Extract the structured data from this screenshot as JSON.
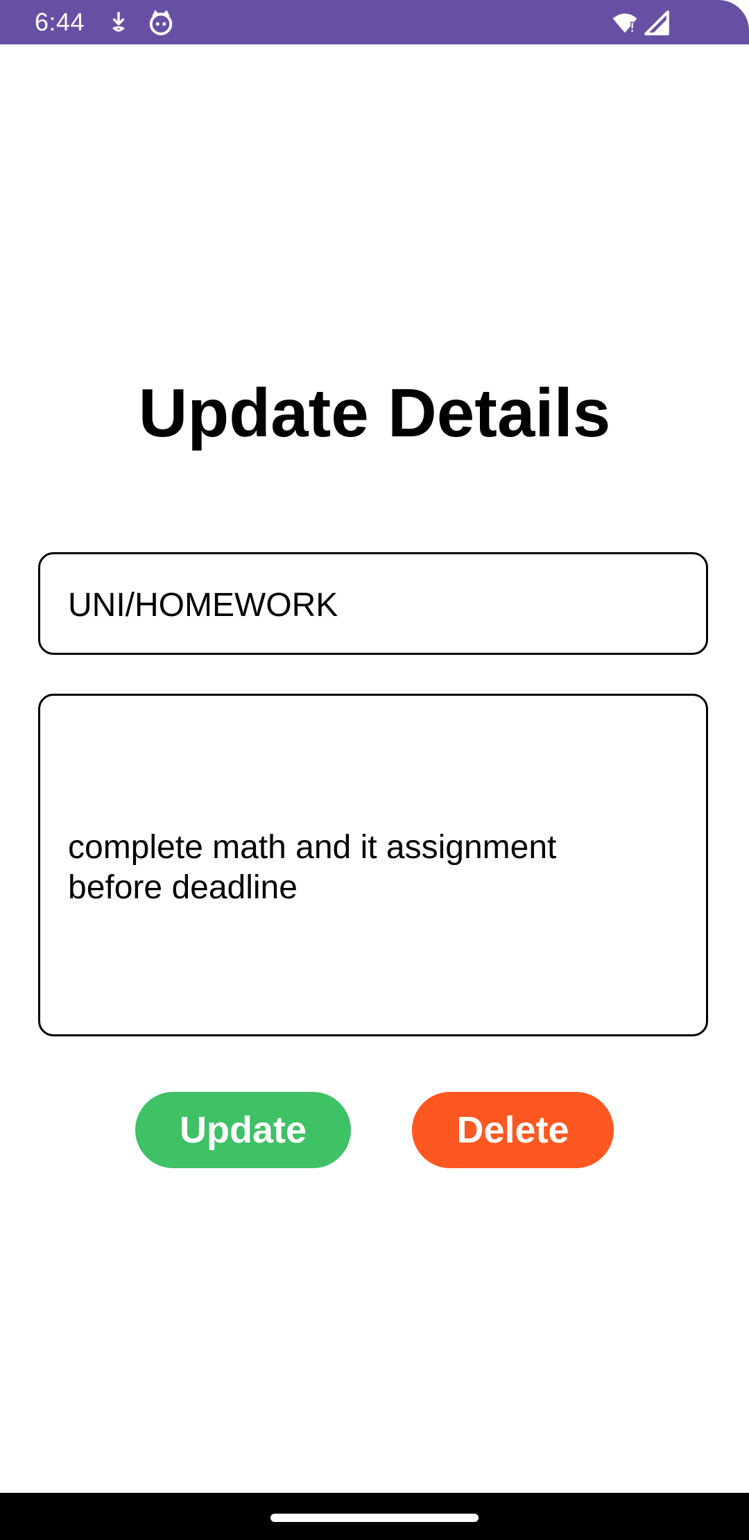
{
  "status_bar": {
    "time": "6:44",
    "icons": [
      "download-icon",
      "face-icon",
      "wifi-icon",
      "signal-icon"
    ],
    "background": "#6750A4"
  },
  "page": {
    "title": "Update Details"
  },
  "form": {
    "title_value": "UNI/HOMEWORK",
    "description_value": "complete math and it assignment\nbefore deadline"
  },
  "buttons": {
    "update_label": "Update",
    "update_color": "#3FC165",
    "delete_label": "Delete",
    "delete_color": "#FF5722"
  }
}
